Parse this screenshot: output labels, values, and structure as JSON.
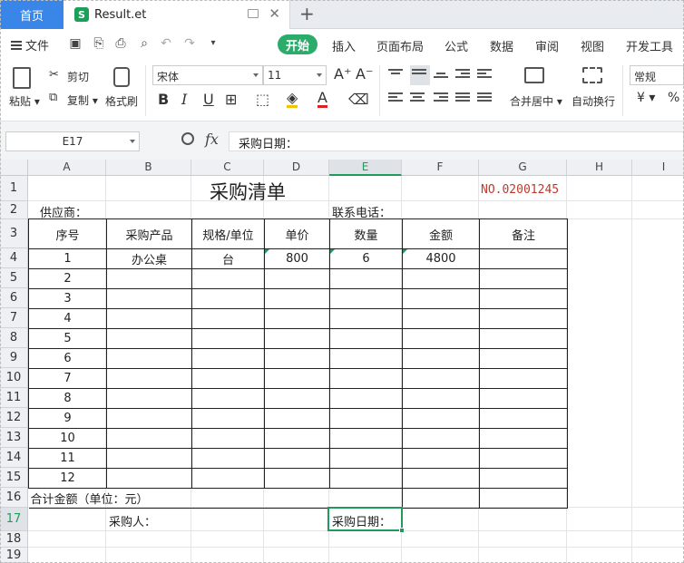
{
  "tabs": {
    "home": "首页",
    "file_icon": "S",
    "file_name": "Result.et"
  },
  "menu": {
    "file": "文件",
    "start": "开始",
    "items": [
      "插入",
      "页面布局",
      "公式",
      "数据",
      "审阅",
      "视图",
      "开发工具"
    ]
  },
  "ribbon": {
    "paste": "粘贴",
    "cut": "剪切",
    "copy": "复制",
    "format_painter": "格式刷",
    "font_name": "宋体",
    "font_size": "11",
    "bold": "B",
    "italic": "I",
    "underline": "U",
    "merge_center": "合并居中",
    "wrap_text": "自动换行",
    "number_format": "常规",
    "currency": "¥",
    "percent": "%"
  },
  "formula_bar": {
    "name_box": "E17",
    "fx": "fx",
    "content": "采购日期："
  },
  "columns": [
    "A",
    "B",
    "C",
    "D",
    "E",
    "F",
    "G",
    "H",
    "I"
  ],
  "active_column": "E",
  "rows": [
    "1",
    "2",
    "3",
    "4",
    "5",
    "6",
    "7",
    "8",
    "9",
    "10",
    "11",
    "12",
    "13",
    "14",
    "15",
    "16",
    "17",
    "18",
    "19"
  ],
  "active_row": "17",
  "sheet": {
    "title": "采购清单",
    "number": "NO.02001245",
    "supplier_label": "供应商：",
    "phone_label": "联系电话：",
    "headers": [
      "序号",
      "采购产品",
      "规格/单位",
      "单价",
      "数量",
      "金额",
      "备注"
    ],
    "items": [
      {
        "seq": "1",
        "product": "办公桌",
        "unit": "台",
        "price": "800",
        "qty": "6",
        "amount": "4800",
        "note": ""
      },
      {
        "seq": "2",
        "product": "",
        "unit": "",
        "price": "",
        "qty": "",
        "amount": "",
        "note": ""
      },
      {
        "seq": "3",
        "product": "",
        "unit": "",
        "price": "",
        "qty": "",
        "amount": "",
        "note": ""
      },
      {
        "seq": "4",
        "product": "",
        "unit": "",
        "price": "",
        "qty": "",
        "amount": "",
        "note": ""
      },
      {
        "seq": "5",
        "product": "",
        "unit": "",
        "price": "",
        "qty": "",
        "amount": "",
        "note": ""
      },
      {
        "seq": "6",
        "product": "",
        "unit": "",
        "price": "",
        "qty": "",
        "amount": "",
        "note": ""
      },
      {
        "seq": "7",
        "product": "",
        "unit": "",
        "price": "",
        "qty": "",
        "amount": "",
        "note": ""
      },
      {
        "seq": "8",
        "product": "",
        "unit": "",
        "price": "",
        "qty": "",
        "amount": "",
        "note": ""
      },
      {
        "seq": "9",
        "product": "",
        "unit": "",
        "price": "",
        "qty": "",
        "amount": "",
        "note": ""
      },
      {
        "seq": "10",
        "product": "",
        "unit": "",
        "price": "",
        "qty": "",
        "amount": "",
        "note": ""
      },
      {
        "seq": "11",
        "product": "",
        "unit": "",
        "price": "",
        "qty": "",
        "amount": "",
        "note": ""
      },
      {
        "seq": "12",
        "product": "",
        "unit": "",
        "price": "",
        "qty": "",
        "amount": "",
        "note": ""
      }
    ],
    "total_label": "合计金额（单位：元）",
    "buyer_label": "采购人：",
    "date_label": "采购日期："
  },
  "colors": {
    "accent": "#2cac6a",
    "home_tab": "#3a86e8",
    "number_red": "#c0392b"
  }
}
